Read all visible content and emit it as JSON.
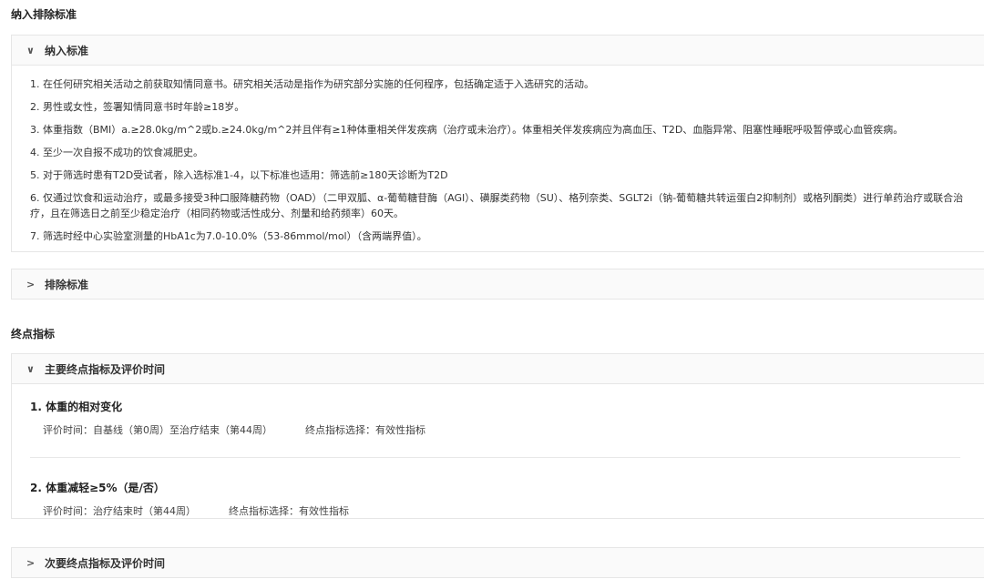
{
  "inclusion_section": {
    "title": "纳入排除标准",
    "inclusion_panel": {
      "label": "纳入标准",
      "chevron": "chevron-down-icon",
      "items": [
        "1. 在任何研究相关活动之前获取知情同意书。研究相关活动是指作为研究部分实施的任何程序，包括确定适于入选研究的活动。",
        "2. 男性或女性，签署知情同意书时年龄≥18岁。",
        "3. 体重指数（BMI）a.≥28.0kg/m^2或b.≥24.0kg/m^2并且伴有≥1种体重相关伴发疾病（治疗或未治疗）。体重相关伴发疾病应为高血压、T2D、血脂异常、阻塞性睡眠呼吸暂停或心血管疾病。",
        "4. 至少一次自报不成功的饮食减肥史。",
        "5. 对于筛选时患有T2D受试者，除入选标准1-4，以下标准也适用：筛选前≥180天诊断为T2D",
        "6. 仅通过饮食和运动治疗，或最多接受3种口服降糖药物（OAD）（二甲双胍、α-葡萄糖苷酶（AGI）、磺脲类药物（SU）、格列奈类、SGLT2i（钠-葡萄糖共转运蛋白2抑制剂）或格列酮类）进行单药治疗或联合治疗，且在筛选日之前至少稳定治疗（相同药物或活性成分、剂量和给药频率）60天。",
        "7. 筛选时经中心实验室测量的HbA1c为7.0-10.0%（53-86mmol/mol）（含两端界值）。"
      ]
    },
    "exclusion_panel": {
      "label": "排除标准",
      "chevron": "chevron-right-icon"
    }
  },
  "endpoint_section": {
    "title": "终点指标",
    "primary_panel": {
      "label": "主要终点指标及评价时间",
      "chevron": "chevron-down-icon",
      "endpoints": [
        {
          "title": "1. 体重的相对变化",
          "time": "评价时间：自基线（第0周）至治疗结束（第44周）",
          "type": "终点指标选择：有效性指标"
        },
        {
          "title": "2. 体重减轻≥5%（是/否）",
          "time": "评价时间：治疗结束时（第44周）",
          "type": "终点指标选择：有效性指标"
        }
      ]
    },
    "secondary_panel": {
      "label": "次要终点指标及评价时间",
      "chevron": "chevron-right-icon"
    }
  }
}
